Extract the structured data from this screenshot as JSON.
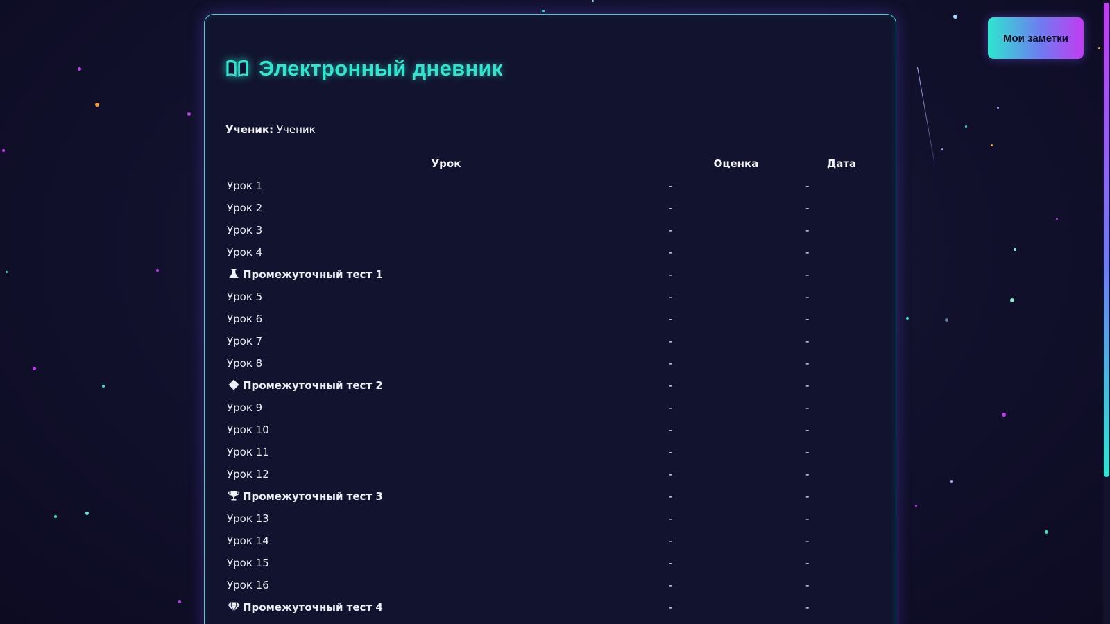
{
  "header": {
    "title": "Электронный дневник",
    "icon": "book-open-icon"
  },
  "student": {
    "label": "Ученик:",
    "name": "Ученик"
  },
  "notes_button": {
    "label": "Мои заметки"
  },
  "table": {
    "headers": [
      "Урок",
      "Оценка",
      "Дата"
    ],
    "rows": [
      {
        "lesson": "Урок 1",
        "grade": "-",
        "date": "-"
      },
      {
        "lesson": "Урок 2",
        "grade": "-",
        "date": "-"
      },
      {
        "lesson": "Урок 3",
        "grade": "-",
        "date": "-"
      },
      {
        "lesson": "Урок 4",
        "grade": "-",
        "date": "-"
      },
      {
        "lesson": "Промежуточный тест 1",
        "grade": "-",
        "date": "-",
        "icon": "flask-icon"
      },
      {
        "lesson": "Урок 5",
        "grade": "-",
        "date": "-"
      },
      {
        "lesson": "Урок 6",
        "grade": "-",
        "date": "-"
      },
      {
        "lesson": "Урок 7",
        "grade": "-",
        "date": "-"
      },
      {
        "lesson": "Урок 8",
        "grade": "-",
        "date": "-"
      },
      {
        "lesson": "Промежуточный тест 2",
        "grade": "-",
        "date": "-",
        "icon": "diamond-icon"
      },
      {
        "lesson": "Урок 9",
        "grade": "-",
        "date": "-"
      },
      {
        "lesson": "Урок 10",
        "grade": "-",
        "date": "-"
      },
      {
        "lesson": "Урок 11",
        "grade": "-",
        "date": "-"
      },
      {
        "lesson": "Урок 12",
        "grade": "-",
        "date": "-"
      },
      {
        "lesson": "Промежуточный тест 3",
        "grade": "-",
        "date": "-",
        "icon": "trophy-icon"
      },
      {
        "lesson": "Урок 13",
        "grade": "-",
        "date": "-"
      },
      {
        "lesson": "Урок 14",
        "grade": "-",
        "date": "-"
      },
      {
        "lesson": "Урок 15",
        "grade": "-",
        "date": "-"
      },
      {
        "lesson": "Урок 16",
        "grade": "-",
        "date": "-"
      },
      {
        "lesson": "Промежуточный тест 4",
        "grade": "-",
        "date": "-",
        "icon": "gem-icon"
      }
    ]
  },
  "colors": {
    "accent": "#2ee6cf",
    "accent_secondary": "#c13cf0",
    "background": "#12142f"
  }
}
